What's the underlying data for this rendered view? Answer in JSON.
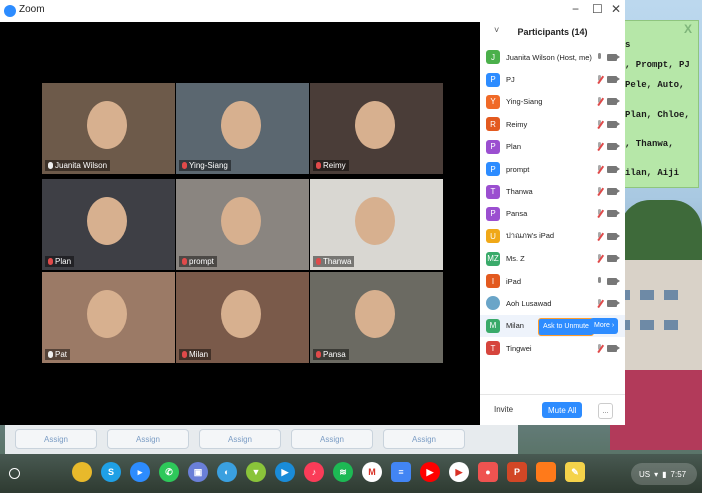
{
  "window": {
    "title": "Zoom",
    "minimize": "−",
    "maximize": "☐",
    "close": "✕"
  },
  "sticky_note": {
    "close": "X",
    "lines": [
      "s",
      ", Prompt, PJ",
      " Pele, Auto,",
      "Plan, Chloe,",
      ", Thanwa,",
      "ilan, Aiji"
    ]
  },
  "assign_row": {
    "label": "Assign"
  },
  "video_tiles": [
    {
      "name": "Juanita Wilson",
      "muted": false,
      "active": true,
      "bg": "#6d5a4a"
    },
    {
      "name": "Ying-Siang",
      "muted": true,
      "active": false,
      "bg": "#5b6770"
    },
    {
      "name": "Reimy",
      "muted": true,
      "active": false,
      "bg": "#4a3d38"
    },
    {
      "name": "Plan",
      "muted": true,
      "active": false,
      "bg": "#3e3f45"
    },
    {
      "name": "prompt",
      "muted": true,
      "active": false,
      "bg": "#8a8580"
    },
    {
      "name": "Thanwa",
      "muted": true,
      "active": false,
      "bg": "#d9d7d2"
    },
    {
      "name": "Pat",
      "muted": false,
      "active": false,
      "bg": "#9b7a66"
    },
    {
      "name": "Milan",
      "muted": true,
      "active": false,
      "bg": "#7a5a4a"
    },
    {
      "name": "Pansa",
      "muted": true,
      "active": false,
      "bg": "#6b6a62"
    }
  ],
  "participants": {
    "title": "Participants (14)",
    "collapse": "˅",
    "list": [
      {
        "initial": "J",
        "name": "Juanita Wilson (Host, me)",
        "color": "#4bb04b",
        "muted": false
      },
      {
        "initial": "P",
        "name": "PJ",
        "color": "#2d8cff",
        "muted": true
      },
      {
        "initial": "Y",
        "name": "Ying-Siang",
        "color": "#f06a28",
        "muted": true
      },
      {
        "initial": "R",
        "name": "Reimy",
        "color": "#e35a1f",
        "muted": true
      },
      {
        "initial": "P",
        "name": "Plan",
        "color": "#9b4fd0",
        "muted": true
      },
      {
        "initial": "P",
        "name": "prompt",
        "color": "#2d8cff",
        "muted": true
      },
      {
        "initial": "T",
        "name": "Thanwa",
        "color": "#9b4fd0",
        "muted": true
      },
      {
        "initial": "P",
        "name": "Pansa",
        "color": "#9b4fd0",
        "muted": true
      },
      {
        "initial": "U",
        "name": "ปาณภพ's iPad",
        "color": "#f0a818",
        "muted": true
      },
      {
        "initial": "MZ",
        "name": "Ms. Z",
        "color": "#3aaa6a",
        "muted": true
      },
      {
        "initial": "I",
        "name": "iPad",
        "color": "#e35a1f",
        "muted": false
      },
      {
        "initial": "",
        "name": "Aoh Lusawad",
        "color": "#6aa5c8",
        "muted": true
      },
      {
        "initial": "M",
        "name": "Milan",
        "color": "#3aaa6a",
        "muted": true
      },
      {
        "initial": "T",
        "name": "Tingwei",
        "color": "#d6453d",
        "muted": true
      }
    ],
    "ask_to_unmute": "Ask to Unmute",
    "more": "More ›",
    "invite": "Invite",
    "mute_all": "Mute All",
    "overflow": "..."
  },
  "shelf": {
    "apps": [
      {
        "name": "chrome",
        "color": "#e8b92b",
        "label": ""
      },
      {
        "name": "skype",
        "color": "#1fa0e6",
        "label": "S"
      },
      {
        "name": "zoom",
        "color": "#2d8cff",
        "label": "▸"
      },
      {
        "name": "whatsapp",
        "color": "#2ec85a",
        "label": "✆"
      },
      {
        "name": "photos",
        "color": "#6a7fd8",
        "label": "▣"
      },
      {
        "name": "browser",
        "color": "#3aa0e0",
        "label": "◐"
      },
      {
        "name": "play-games",
        "color": "#8ac43a",
        "label": "▼"
      },
      {
        "name": "meet",
        "color": "#1a8cd8",
        "label": "▶"
      },
      {
        "name": "music",
        "color": "#fa3c58",
        "label": "♪"
      },
      {
        "name": "spotify",
        "color": "#1db954",
        "label": "≋"
      },
      {
        "name": "gmail",
        "color": "#ffffff",
        "label": "M"
      },
      {
        "name": "docs",
        "color": "#4285f4",
        "label": "≡"
      },
      {
        "name": "youtube",
        "color": "#ff0000",
        "label": "▶"
      },
      {
        "name": "play-store",
        "color": "#ffffff",
        "label": "▶"
      },
      {
        "name": "clips",
        "color": "#ef5350",
        "label": "●"
      },
      {
        "name": "powerpoint",
        "color": "#d24726",
        "label": "P"
      },
      {
        "name": "app-orange",
        "color": "#ff7a1a",
        "label": ""
      },
      {
        "name": "notes",
        "color": "#f5d34a",
        "label": "✎"
      }
    ],
    "tray": {
      "locale": "US",
      "time": "7:57"
    }
  }
}
